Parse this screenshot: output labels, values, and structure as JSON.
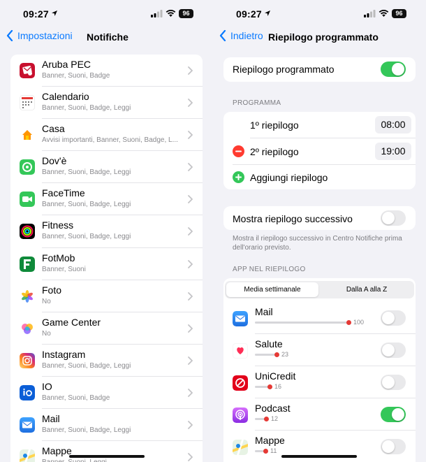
{
  "left": {
    "status": {
      "time": "09:27",
      "battery": "96"
    },
    "nav": {
      "back_label": "Impostazioni",
      "title": "Notifiche"
    },
    "apps": [
      {
        "name": "Aruba PEC",
        "sub": "Banner, Suoni, Badge",
        "icon": "aruba-pec-icon",
        "color": "#c8102e"
      },
      {
        "name": "Calendario",
        "sub": "Banner, Suoni, Badge, Leggi",
        "icon": "calendar-icon",
        "color": "#ffffff"
      },
      {
        "name": "Casa",
        "sub": "Avvisi importanti, Banner, Suoni, Badge, L...",
        "icon": "home-icon",
        "color": "#ffffff"
      },
      {
        "name": "Dov'è",
        "sub": "Banner, Suoni, Badge, Leggi",
        "icon": "find-my-icon",
        "color": "#34c759"
      },
      {
        "name": "FaceTime",
        "sub": "Banner, Suoni, Badge, Leggi",
        "icon": "facetime-icon",
        "color": "#34c759"
      },
      {
        "name": "Fitness",
        "sub": "Banner, Suoni, Badge, Leggi",
        "icon": "fitness-icon",
        "color": "#000000"
      },
      {
        "name": "FotMob",
        "sub": "Banner, Suoni",
        "icon": "fotmob-icon",
        "color": "#0f8a3a"
      },
      {
        "name": "Foto",
        "sub": "No",
        "icon": "photos-icon",
        "color": "#ffffff"
      },
      {
        "name": "Game Center",
        "sub": "No",
        "icon": "game-center-icon",
        "color": "#ffffff"
      },
      {
        "name": "Instagram",
        "sub": "Banner, Suoni, Badge, Leggi",
        "icon": "instagram-icon",
        "color": "#d6249f"
      },
      {
        "name": "IO",
        "sub": "Banner, Suoni, Badge",
        "icon": "io-app-icon",
        "color": "#0b5ed7"
      },
      {
        "name": "Mail",
        "sub": "Banner, Suoni, Badge, Leggi",
        "icon": "mail-icon",
        "color": "#1e88e5"
      },
      {
        "name": "Mappe",
        "sub": "Banner, Suoni, Leggi",
        "icon": "maps-icon",
        "color": "#ffffff"
      }
    ]
  },
  "right": {
    "status": {
      "time": "09:27",
      "battery": "96"
    },
    "nav": {
      "back_label": "Indietro",
      "title": "Riepilogo programmato"
    },
    "main_toggle": {
      "label": "Riepilogo programmato",
      "on": true
    },
    "program": {
      "header": "PROGRAMMA",
      "first": {
        "label": "1º riepilogo",
        "time": "08:00"
      },
      "second": {
        "label": "2º riepilogo",
        "time": "19:00"
      },
      "add_label": "Aggiungi riepilogo"
    },
    "next_summary": {
      "label": "Mostra riepilogo successivo",
      "on": false,
      "note": "Mostra il riepilogo successivo in Centro Notifiche prima dell'orario previsto."
    },
    "apps_header": "APP NEL RIEPILOGO",
    "segment": {
      "selected": "Media settimanale",
      "other": "Dalla A alla Z"
    },
    "summary_apps": [
      {
        "name": "Mail",
        "count": 100,
        "on": false,
        "icon": "mail-icon"
      },
      {
        "name": "Salute",
        "count": 23,
        "on": false,
        "icon": "health-icon"
      },
      {
        "name": "UniCredit",
        "count": 16,
        "on": false,
        "icon": "unicredit-icon"
      },
      {
        "name": "Podcast",
        "count": 12,
        "on": true,
        "icon": "podcast-icon"
      },
      {
        "name": "Mappe",
        "count": 11,
        "on": false,
        "icon": "maps-icon"
      }
    ]
  }
}
